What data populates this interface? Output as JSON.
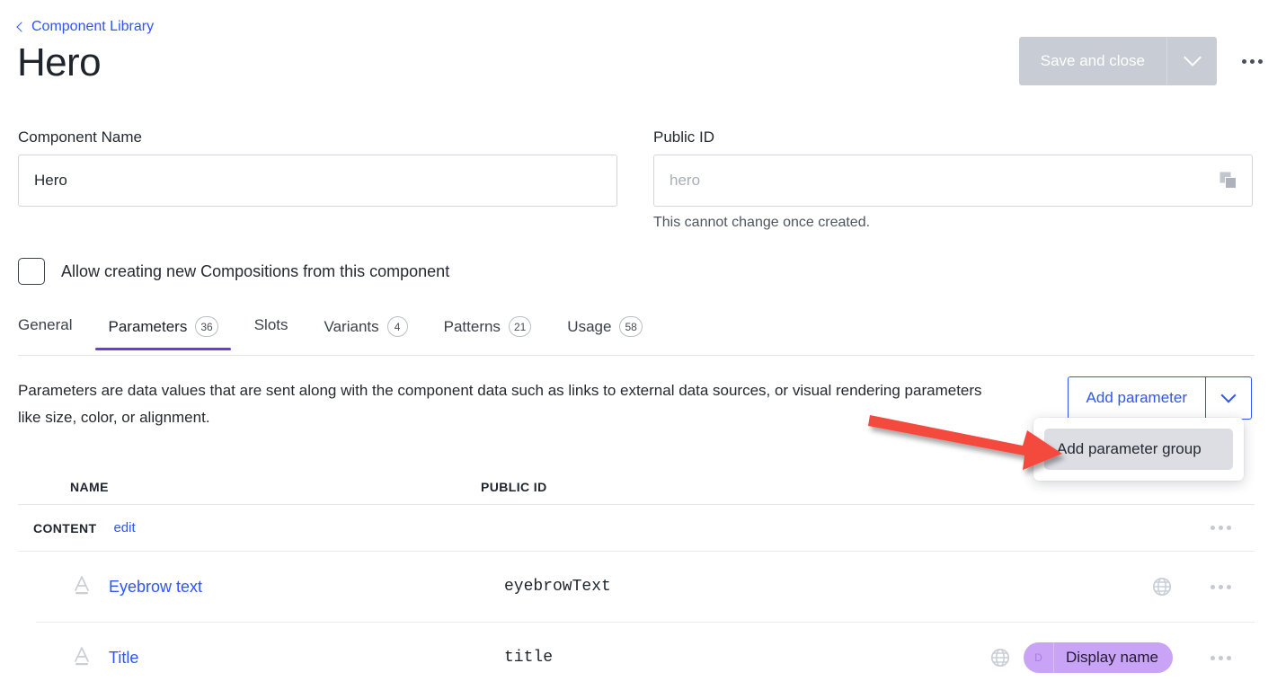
{
  "header": {
    "breadcrumb_label": "Component Library",
    "breadcrumb_icon": "chevron-left-icon",
    "title": "Hero",
    "save_label": "Save and close",
    "save_caret_icon": "chevron-down-icon",
    "overflow_icon": "ellipsis-icon"
  },
  "form": {
    "component_name": {
      "label": "Component Name",
      "value": "Hero",
      "placeholder": ""
    },
    "public_id": {
      "label": "Public ID",
      "value": "",
      "placeholder": "hero",
      "hint": "This cannot change once created.",
      "copy_icon": "copy-icon"
    },
    "allow_compositions": {
      "label": "Allow creating new Compositions from this component",
      "checked": false
    }
  },
  "tabs": [
    {
      "label": "General",
      "badge": "",
      "active": false
    },
    {
      "label": "Parameters",
      "badge": "36",
      "active": true
    },
    {
      "label": "Slots",
      "badge": "",
      "active": false
    },
    {
      "label": "Variants",
      "badge": "4",
      "active": false
    },
    {
      "label": "Patterns",
      "badge": "21",
      "active": false
    },
    {
      "label": "Usage",
      "badge": "58",
      "active": false
    }
  ],
  "parameters_panel": {
    "description": "Parameters are data values that are sent along with the component data such as links to external data sources, or visual rendering parameters like size, color, or alignment.",
    "add_button_label": "Add parameter",
    "add_caret_icon": "chevron-down-icon",
    "dropdown": {
      "open": true,
      "items": [
        {
          "label": "Add parameter group",
          "highlighted": true
        }
      ]
    },
    "annotation_arrow": {
      "icon": "arrow-right-annotation",
      "color": "#f4483c"
    }
  },
  "table": {
    "columns": [
      "NAME",
      "PUBLIC ID"
    ],
    "groups": [
      {
        "name": "CONTENT",
        "edit_label": "edit",
        "menu_icon": "ellipsis-icon",
        "rows": [
          {
            "type_icon": "text-type-icon",
            "name": "Eyebrow text",
            "public_id": "eyebrowText",
            "localized_icon": "globe-icon",
            "badge": "",
            "badge_glyph": "",
            "menu_icon": "ellipsis-icon"
          },
          {
            "type_icon": "text-type-icon",
            "name": "Title",
            "public_id": "title",
            "localized_icon": "globe-icon",
            "badge": "Display name",
            "badge_glyph": "D",
            "menu_icon": "ellipsis-icon"
          }
        ]
      }
    ]
  },
  "colors": {
    "link": "#2f55f7",
    "accent_purple": "#6a3fd9",
    "badge_purple": "#c9a3f5",
    "annotation_red": "#f4483c",
    "disabled_gray": "#c8ccd4"
  }
}
